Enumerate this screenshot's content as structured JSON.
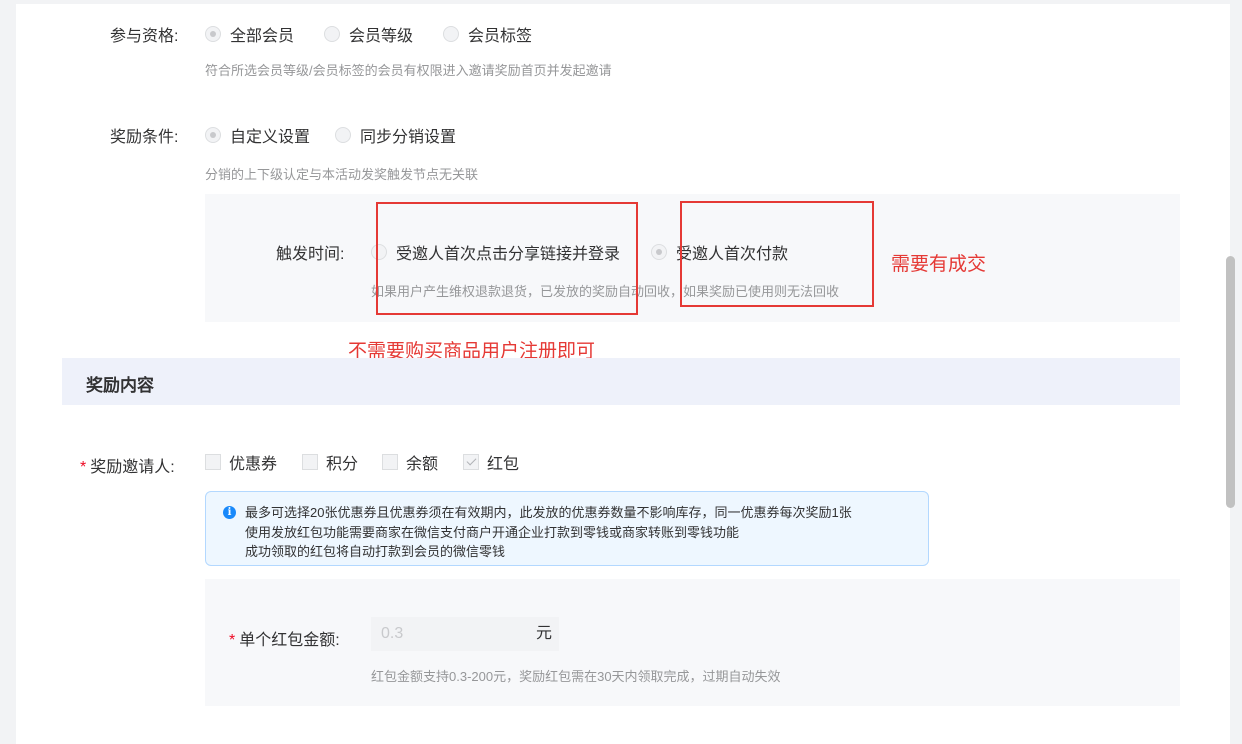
{
  "eligibility": {
    "label": "参与资格:",
    "options": [
      "全部会员",
      "会员等级",
      "会员标签"
    ],
    "selected": "全部会员",
    "help": "符合所选会员等级/会员标签的会员有权限进入邀请奖励首页并发起邀请"
  },
  "reward_condition": {
    "label": "奖励条件:",
    "options": [
      "自定义设置",
      "同步分销设置"
    ],
    "selected": "自定义设置",
    "help": "分销的上下级认定与本活动发奖触发节点无关联"
  },
  "trigger": {
    "label": "触发时间:",
    "options": [
      "受邀人首次点击分享链接并登录",
      "受邀人首次付款"
    ],
    "selected": "受邀人首次付款",
    "help": "如果用户产生维权退款退货，已发放的奖励自动回收，如果奖励已使用则无法回收"
  },
  "annotations": {
    "no_purchase": "不需要购买商品用户注册即可",
    "need_deal": "需要有成交"
  },
  "reward_content": {
    "title": "奖励内容",
    "inviter_label": "奖励邀请人:",
    "options": [
      {
        "label": "优惠券",
        "checked": false
      },
      {
        "label": "积分",
        "checked": false
      },
      {
        "label": "余额",
        "checked": false
      },
      {
        "label": "红包",
        "checked": true
      }
    ],
    "info_lines": [
      "最多可选择20张优惠券且优惠券须在有效期内，此发放的优惠券数量不影响库存，同一优惠券每次奖励1张",
      "使用发放红包功能需要商家在微信支付商户开通企业打款到零钱或商家转账到零钱功能",
      "成功领取的红包将自动打款到会员的微信零钱"
    ],
    "amount_label": "单个红包金额:",
    "amount_placeholder": "0.3",
    "amount_unit": "元",
    "amount_help": "红包金额支持0.3-200元，奖励红包需在30天内领取完成，过期自动失效"
  },
  "colors": {
    "annotation_red": "#e53935",
    "info_blue": "#1989fa",
    "required_star": "#ee0a24"
  }
}
